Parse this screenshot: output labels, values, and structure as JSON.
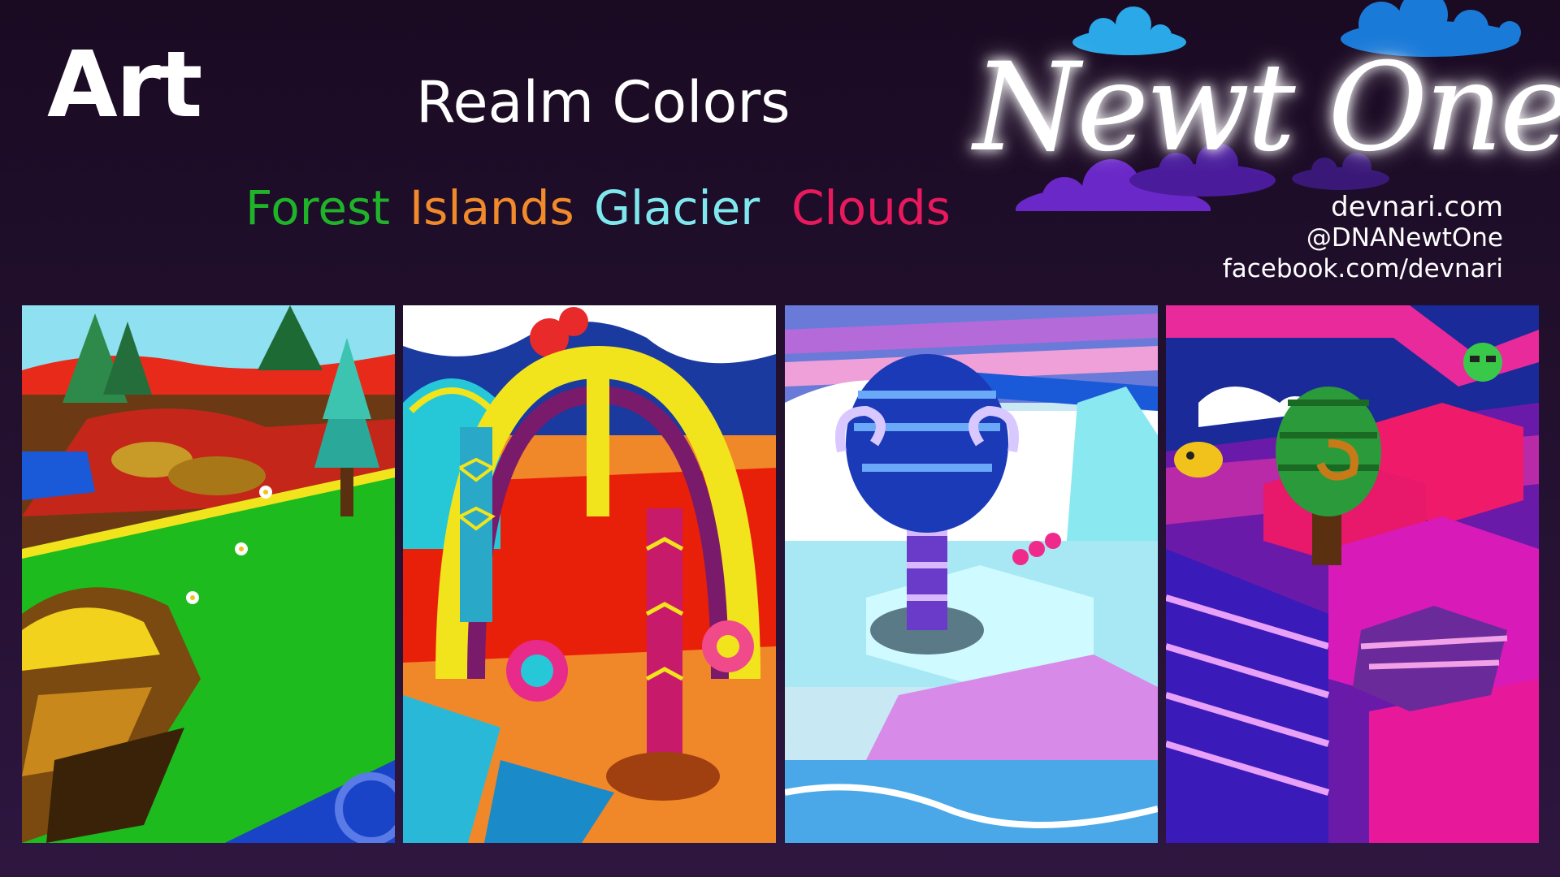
{
  "header": {
    "title": "Art",
    "subtitle": "Realm  Colors"
  },
  "realms": [
    {
      "label": "Forest",
      "color": "#1fb32a"
    },
    {
      "label": "Islands",
      "color": "#f08a2a"
    },
    {
      "label": "Glacier",
      "color": "#7fe8ee"
    },
    {
      "label": "Clouds",
      "color": "#e8195c"
    }
  ],
  "logo": {
    "text": "Newt One"
  },
  "contact": {
    "website": "devnari.com",
    "twitter": "@DNANewtOne",
    "facebook": "facebook.com/devnari"
  },
  "panels": [
    {
      "name": "forest",
      "accent": "#1fb32a"
    },
    {
      "name": "islands",
      "accent": "#f08a2a"
    },
    {
      "name": "glacier",
      "accent": "#7fe8ee"
    },
    {
      "name": "clouds",
      "accent": "#e8195c"
    }
  ]
}
